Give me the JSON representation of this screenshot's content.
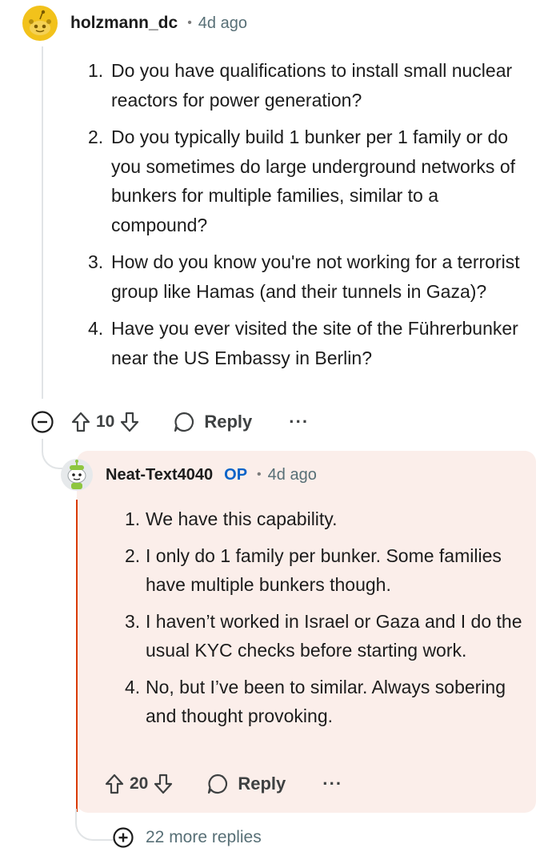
{
  "comment": {
    "username": "holzmann_dc",
    "separator": "•",
    "timestamp": "4d ago",
    "items": [
      {
        "num": "1.",
        "text": "Do you have qualifications to install small nuclear reactors for power generation?"
      },
      {
        "num": "2.",
        "text": "Do you typically build 1 bunker per 1 family or do you sometimes do large underground networks of bunkers for multiple families, similar to a compound?"
      },
      {
        "num": "3.",
        "text": "How do you know you're not working for a terrorist group like Hamas (and their tunnels in Gaza)?"
      },
      {
        "num": "4.",
        "text": "Have you ever visited the site of the Führerbunker near the US Embassy in Berlin?"
      }
    ],
    "votes": "10",
    "reply_label": "Reply",
    "more_label": "···"
  },
  "reply": {
    "username": "Neat-Text4040",
    "op_badge": "OP",
    "separator": "•",
    "timestamp": "4d ago",
    "items": [
      {
        "num": "1.",
        "text": "We have this capability."
      },
      {
        "num": "2.",
        "text": "I only do 1 family per bunker. Some families have multiple bunkers though."
      },
      {
        "num": "3.",
        "text": "I haven’t worked in Israel or Gaza and I do the usual KYC checks before starting work."
      },
      {
        "num": "4.",
        "text": "No, but I’ve been to similar. Always sobering and thought provoking."
      }
    ],
    "votes": "20",
    "reply_label": "Reply",
    "more_label": "···"
  },
  "more_replies": {
    "label": "22 more replies"
  },
  "colors": {
    "accent_op": "#0a63c8",
    "reply_card_bg": "#fbeeea",
    "reply_accent_line": "#d93a00",
    "avatar_yellow": "#f2c21b"
  },
  "icons": {
    "collapse": "collapse-minus-icon",
    "upvote": "upvote-arrow-icon",
    "downvote": "downvote-arrow-icon",
    "reply": "speech-bubble-icon",
    "expand": "expand-plus-icon"
  }
}
